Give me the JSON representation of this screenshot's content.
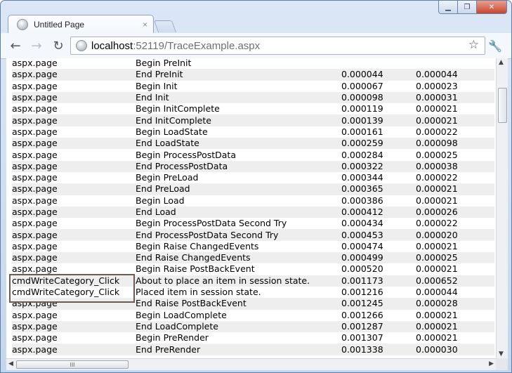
{
  "window": {
    "controls": {
      "minimize": "▁",
      "restore": "❐",
      "close": "✕"
    }
  },
  "tab": {
    "title": "Untitled Page",
    "close": "×"
  },
  "toolbar": {
    "back": "←",
    "forward": "→",
    "reload": "↻",
    "url_host": "localhost",
    "url_rest": ":52119/TraceExample.aspx",
    "star": "☆",
    "wrench": "🔧"
  },
  "trace_rows": [
    {
      "category": "aspx.page",
      "message": "Begin PreInit",
      "from_first": "",
      "from_last": ""
    },
    {
      "category": "aspx.page",
      "message": "End PreInit",
      "from_first": "0.000044",
      "from_last": "0.000044"
    },
    {
      "category": "aspx.page",
      "message": "Begin Init",
      "from_first": "0.000067",
      "from_last": "0.000023"
    },
    {
      "category": "aspx.page",
      "message": "End Init",
      "from_first": "0.000098",
      "from_last": "0.000031"
    },
    {
      "category": "aspx.page",
      "message": "Begin InitComplete",
      "from_first": "0.000119",
      "from_last": "0.000021"
    },
    {
      "category": "aspx.page",
      "message": "End InitComplete",
      "from_first": "0.000139",
      "from_last": "0.000021"
    },
    {
      "category": "aspx.page",
      "message": "Begin LoadState",
      "from_first": "0.000161",
      "from_last": "0.000022"
    },
    {
      "category": "aspx.page",
      "message": "End LoadState",
      "from_first": "0.000259",
      "from_last": "0.000098"
    },
    {
      "category": "aspx.page",
      "message": "Begin ProcessPostData",
      "from_first": "0.000284",
      "from_last": "0.000025"
    },
    {
      "category": "aspx.page",
      "message": "End ProcessPostData",
      "from_first": "0.000322",
      "from_last": "0.000038"
    },
    {
      "category": "aspx.page",
      "message": "Begin PreLoad",
      "from_first": "0.000344",
      "from_last": "0.000022"
    },
    {
      "category": "aspx.page",
      "message": "End PreLoad",
      "from_first": "0.000365",
      "from_last": "0.000021"
    },
    {
      "category": "aspx.page",
      "message": "Begin Load",
      "from_first": "0.000386",
      "from_last": "0.000021"
    },
    {
      "category": "aspx.page",
      "message": "End Load",
      "from_first": "0.000412",
      "from_last": "0.000026"
    },
    {
      "category": "aspx.page",
      "message": "Begin ProcessPostData Second Try",
      "from_first": "0.000434",
      "from_last": "0.000022"
    },
    {
      "category": "aspx.page",
      "message": "End ProcessPostData Second Try",
      "from_first": "0.000453",
      "from_last": "0.000020"
    },
    {
      "category": "aspx.page",
      "message": "Begin Raise ChangedEvents",
      "from_first": "0.000474",
      "from_last": "0.000021"
    },
    {
      "category": "aspx.page",
      "message": "End Raise ChangedEvents",
      "from_first": "0.000499",
      "from_last": "0.000025"
    },
    {
      "category": "aspx.page",
      "message": "Begin Raise PostBackEvent",
      "from_first": "0.000520",
      "from_last": "0.000021"
    },
    {
      "category": "cmdWriteCategory_Click",
      "message": "About to place an item in session state.",
      "from_first": "0.001173",
      "from_last": "0.000652"
    },
    {
      "category": "cmdWriteCategory_Click",
      "message": "Placed item in session state.",
      "from_first": "0.001216",
      "from_last": "0.000044"
    },
    {
      "category": "aspx.page",
      "message": "End Raise PostBackEvent",
      "from_first": "0.001245",
      "from_last": "0.000028"
    },
    {
      "category": "aspx.page",
      "message": "Begin LoadComplete",
      "from_first": "0.001266",
      "from_last": "0.000021"
    },
    {
      "category": "aspx.page",
      "message": "End LoadComplete",
      "from_first": "0.001287",
      "from_last": "0.000021"
    },
    {
      "category": "aspx.page",
      "message": "Begin PreRender",
      "from_first": "0.001307",
      "from_last": "0.000021"
    },
    {
      "category": "aspx.page",
      "message": "End PreRender",
      "from_first": "0.001338",
      "from_last": "0.000030"
    }
  ],
  "scrollbars": {
    "up": "▲",
    "down": "▼",
    "left": "◀",
    "right": "▶",
    "grip": "III"
  }
}
